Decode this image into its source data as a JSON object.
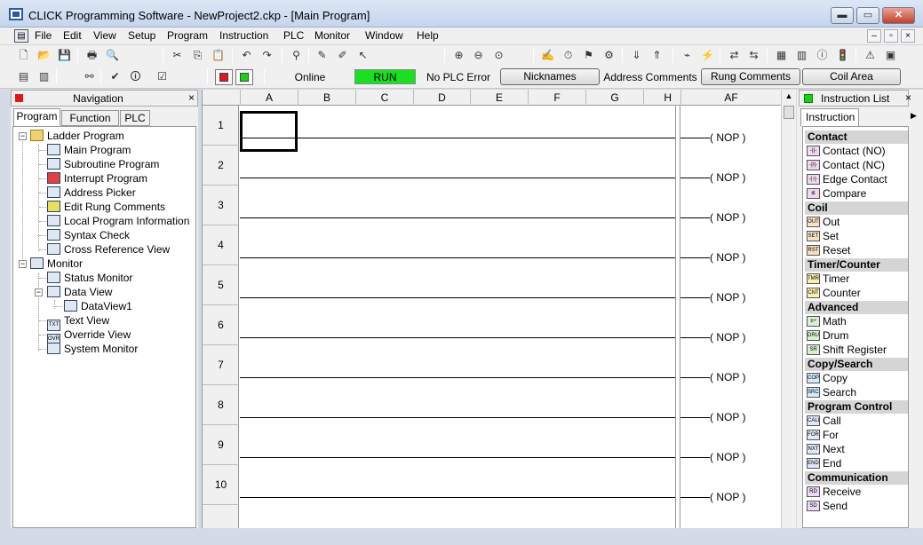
{
  "window": {
    "title": "CLICK Programming Software - NewProject2.ckp - [Main Program]",
    "minimize": "▬",
    "maximize": "▭",
    "close": "✕"
  },
  "menu": [
    "File",
    "Edit",
    "View",
    "Setup",
    "Program",
    "Instruction",
    "PLC",
    "Monitor",
    "Window",
    "Help"
  ],
  "mdi": {
    "minimize": "–",
    "restore": "▫",
    "close": "×"
  },
  "status": {
    "online": "Online",
    "run": "RUN",
    "error": "No PLC Error",
    "nicknames": "Nicknames",
    "address_comments": "Address Comments",
    "rung_comments": "Rung Comments",
    "coil_area": "Coil Area"
  },
  "navigation": {
    "title": "Navigation",
    "close": "×",
    "tabs": [
      "Program",
      "Function",
      "PLC"
    ],
    "tree": {
      "ladder_program": "Ladder Program",
      "main_program": "Main Program",
      "subroutine_program": "Subroutine Program",
      "interrupt_program": "Interrupt Program",
      "address_picker": "Address Picker",
      "edit_rung_comments": "Edit Rung Comments",
      "local_program_information": "Local Program Information",
      "syntax_check": "Syntax Check",
      "cross_reference_view": "Cross Reference View",
      "monitor": "Monitor",
      "status_monitor": "Status Monitor",
      "data_view": "Data View",
      "dataview1": "DataView1",
      "text_view": "Text View",
      "override_view": "Override View",
      "system_monitor": "System Monitor"
    }
  },
  "ladder": {
    "columns": [
      "A",
      "B",
      "C",
      "D",
      "E",
      "F",
      "G",
      "H",
      "AF"
    ],
    "rungs": [
      "1",
      "2",
      "3",
      "4",
      "5",
      "6",
      "7",
      "8",
      "9",
      "10"
    ],
    "coil": "( NOP )"
  },
  "instruction_list": {
    "title": "Instruction List",
    "close": "×",
    "tab": "Instruction",
    "categories": {
      "contact": "Contact",
      "coil": "Coil",
      "timer_counter": "Timer/Counter",
      "advanced": "Advanced",
      "copy_search": "Copy/Search",
      "program_control": "Program Control",
      "communication": "Communication"
    },
    "items": {
      "contact_no": "Contact (NO)",
      "contact_nc": "Contact (NC)",
      "edge_contact": "Edge Contact",
      "compare": "Compare",
      "out": "Out",
      "set": "Set",
      "reset": "Reset",
      "timer": "Timer",
      "counter": "Counter",
      "math": "Math",
      "drum": "Drum",
      "shift_register": "Shift Register",
      "copy": "Copy",
      "search": "Search",
      "call": "Call",
      "for": "For",
      "next": "Next",
      "end": "End",
      "receive": "Receive",
      "send": "Send"
    },
    "badges": {
      "out": "OUT",
      "set": "SET",
      "reset": "RST",
      "timer": "TMR",
      "counter": "CNT",
      "drum": "DRUM",
      "shift_register": "SR",
      "copy": "COPY",
      "search": "SRCH",
      "call": "CALL",
      "for": "FOR",
      "next": "NXT",
      "end": "END",
      "receive": "RD",
      "send": "SD",
      "text_view": "TXT",
      "override_view": "OVR"
    }
  }
}
